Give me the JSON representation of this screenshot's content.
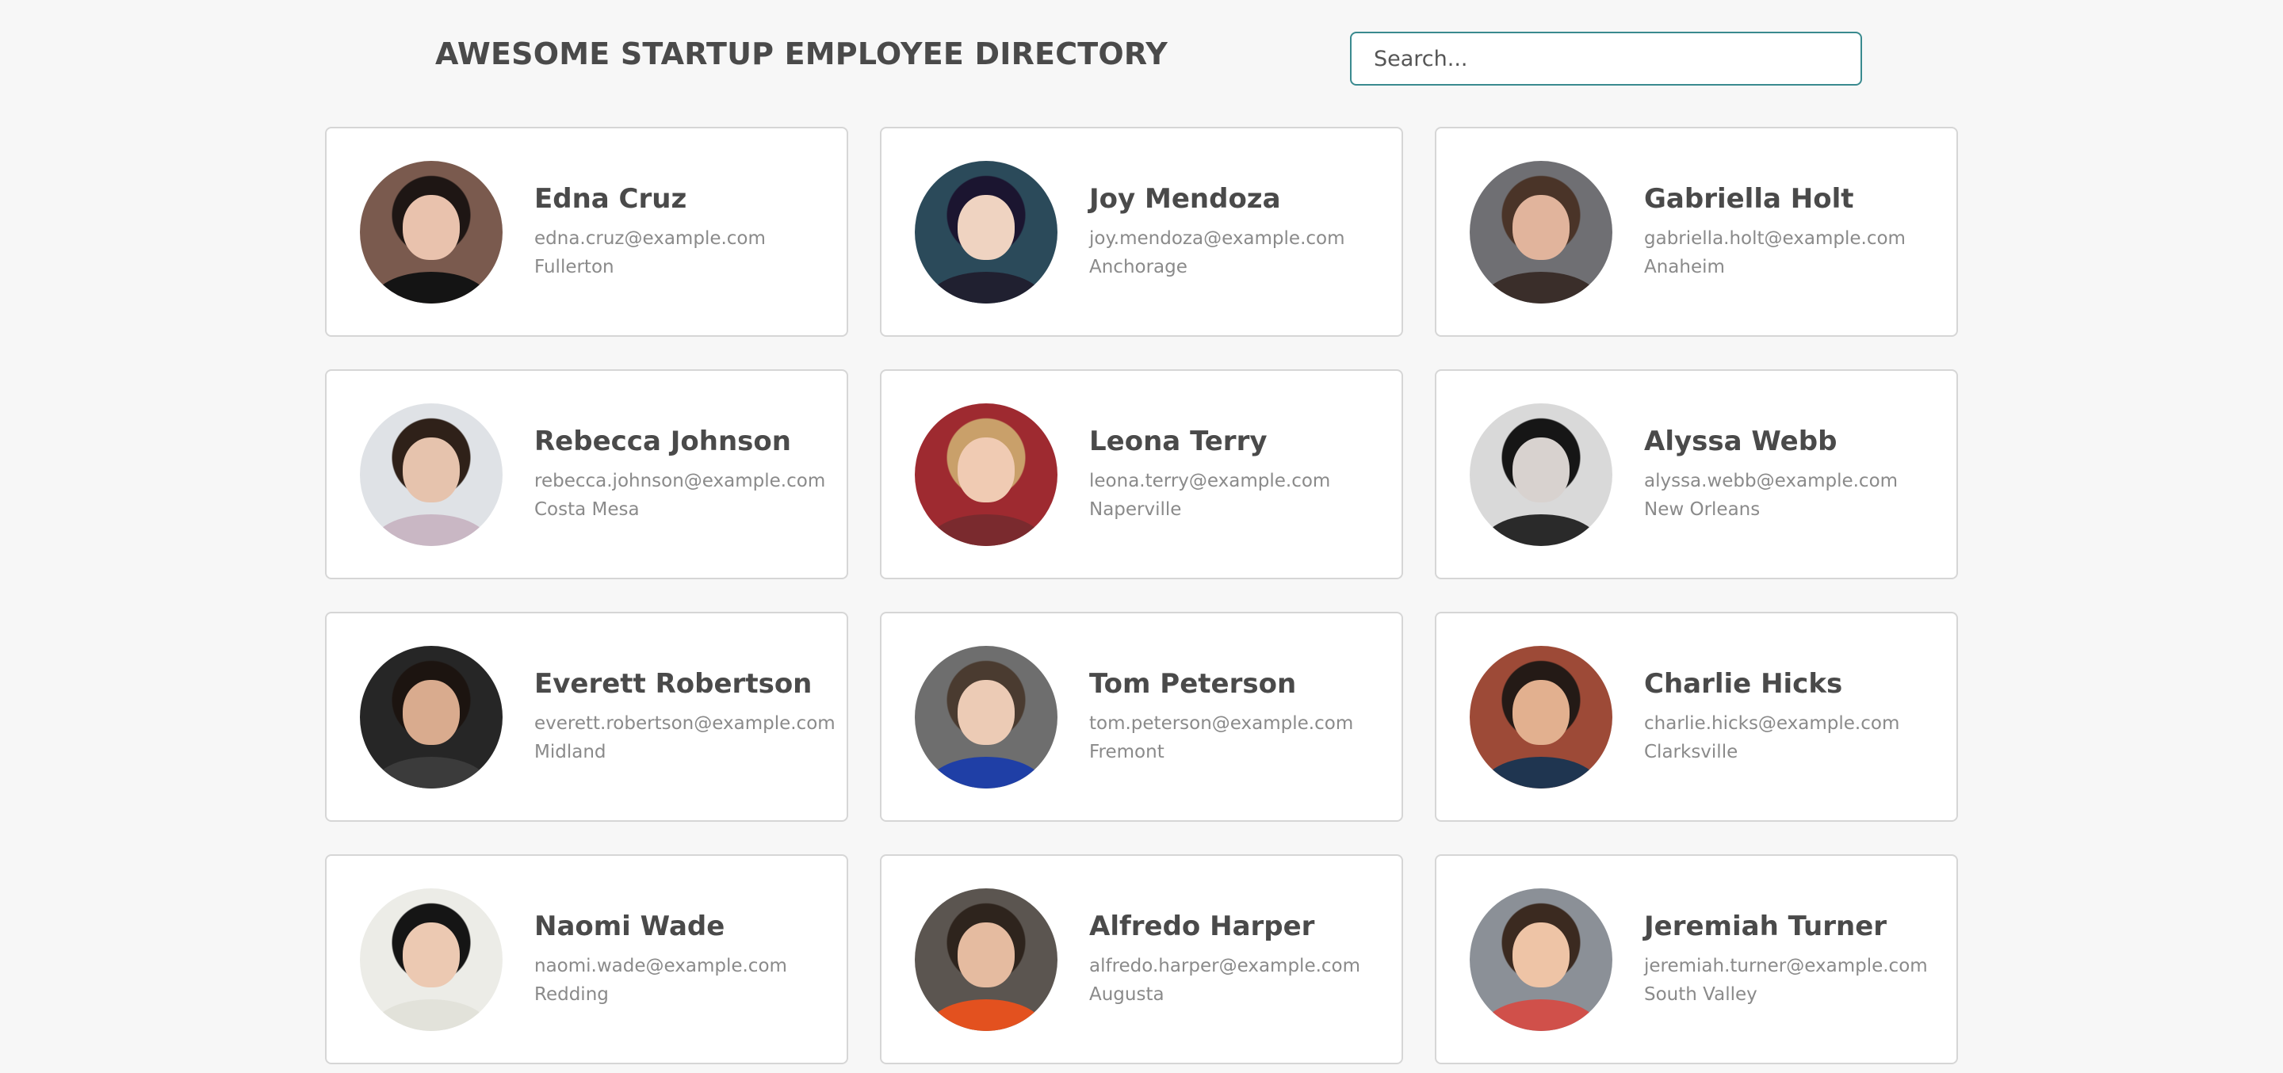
{
  "header": {
    "title": "AWESOME STARTUP EMPLOYEE DIRECTORY"
  },
  "search": {
    "placeholder": "Search..."
  },
  "employees": [
    {
      "name": "Edna Cruz",
      "email": "edna.cruz@example.com",
      "city": "Fullerton",
      "avatar": {
        "bg": "#7a5a4e",
        "hair": "#1e1614",
        "skin": "#e9c2ad",
        "shirt": "#141414"
      }
    },
    {
      "name": "Joy Mendoza",
      "email": "joy.mendoza@example.com",
      "city": "Anchorage",
      "avatar": {
        "bg": "#2b4a5a",
        "hair": "#1b1530",
        "skin": "#efd3c1",
        "shirt": "#202030"
      }
    },
    {
      "name": "Gabriella Holt",
      "email": "gabriella.holt@example.com",
      "city": "Anaheim",
      "avatar": {
        "bg": "#6f6f73",
        "hair": "#4a3428",
        "skin": "#e1b49c",
        "shirt": "#3a2e2a"
      }
    },
    {
      "name": "Rebecca Johnson",
      "email": "rebecca.johnson@example.com",
      "city": "Costa Mesa",
      "avatar": {
        "bg": "#dfe2e6",
        "hair": "#2f2119",
        "skin": "#e6c3ad",
        "shirt": "#c9b7c4"
      }
    },
    {
      "name": "Leona Terry",
      "email": "leona.terry@example.com",
      "city": "Naperville",
      "avatar": {
        "bg": "#9e2a30",
        "hair": "#c9a06a",
        "skin": "#f0cbb3",
        "shirt": "#7a2a2e"
      }
    },
    {
      "name": "Alyssa Webb",
      "email": "alyssa.webb@example.com",
      "city": "New Orleans",
      "avatar": {
        "bg": "#d9d9d9",
        "hair": "#161616",
        "skin": "#d8d2cf",
        "shirt": "#2a2a2a"
      }
    },
    {
      "name": "Everett Robertson",
      "email": "everett.robertson@example.com",
      "city": "Midland",
      "avatar": {
        "bg": "#262626",
        "hair": "#1c1410",
        "skin": "#d9ab8e",
        "shirt": "#3b3b3b"
      }
    },
    {
      "name": "Tom Peterson",
      "email": "tom.peterson@example.com",
      "city": "Fremont",
      "avatar": {
        "bg": "#6e6e6e",
        "hair": "#4a3b30",
        "skin": "#eccbb5",
        "shirt": "#1f3fa6"
      }
    },
    {
      "name": "Charlie Hicks",
      "email": "charlie.hicks@example.com",
      "city": "Clarksville",
      "avatar": {
        "bg": "#9d4a37",
        "hair": "#241a16",
        "skin": "#e2b08f",
        "shirt": "#1f3550"
      }
    },
    {
      "name": "Naomi Wade",
      "email": "naomi.wade@example.com",
      "city": "Redding",
      "avatar": {
        "bg": "#ecece7",
        "hair": "#151515",
        "skin": "#ecc9b2",
        "shirt": "#e2e2da"
      }
    },
    {
      "name": "Alfredo Harper",
      "email": "alfredo.harper@example.com",
      "city": "Augusta",
      "avatar": {
        "bg": "#5b5550",
        "hair": "#2e241d",
        "skin": "#e5bba0",
        "shirt": "#e3511f"
      }
    },
    {
      "name": "Jeremiah Turner",
      "email": "jeremiah.turner@example.com",
      "city": "South Valley",
      "avatar": {
        "bg": "#8b9097",
        "hair": "#3b2a20",
        "skin": "#eec4a6",
        "shirt": "#d0504a"
      }
    }
  ]
}
